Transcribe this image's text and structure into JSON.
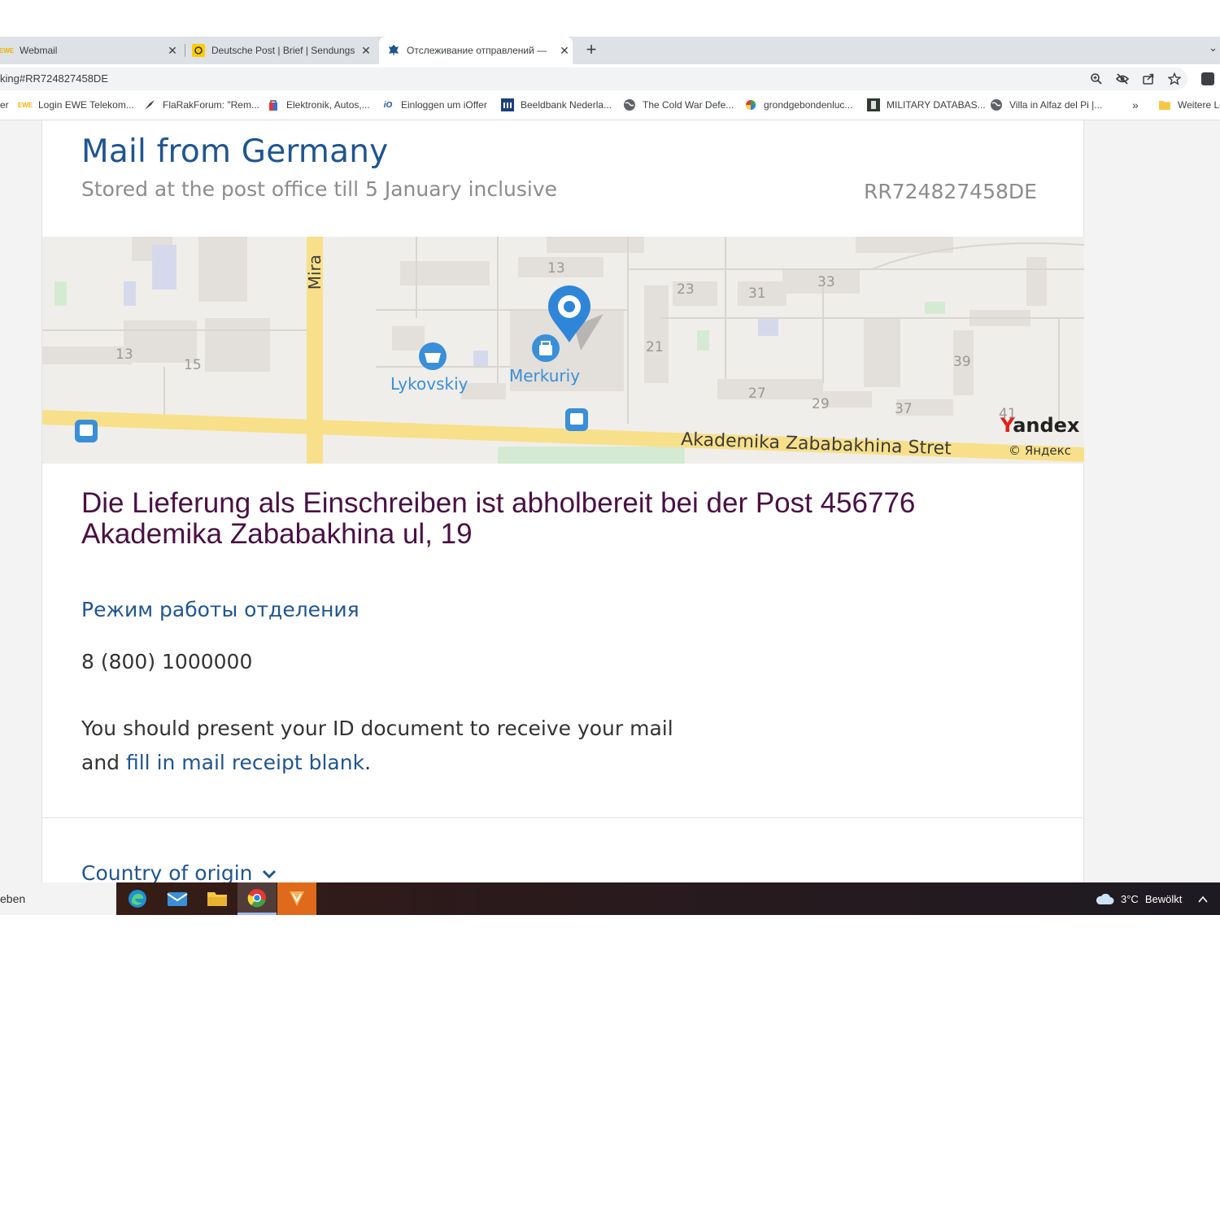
{
  "browser": {
    "tabs": [
      {
        "title": "Webmail",
        "favicon": "ewe-icon"
      },
      {
        "title": "Deutsche Post | Brief | Sendungs",
        "favicon": "deutsche-post-icon"
      },
      {
        "title": "Отслеживание отправлений —",
        "favicon": "russian-post-icon"
      }
    ],
    "new_tab_label": "+",
    "url": "king#RR724827458DE",
    "bookmarks": [
      {
        "label": "er"
      },
      {
        "label": "Login EWE Telekom..."
      },
      {
        "label": "FlaRakForum: \"Rem..."
      },
      {
        "label": "Elektronik, Autos,..."
      },
      {
        "label": "Einloggen um iOffer"
      },
      {
        "label": "Beeldbank Nederla..."
      },
      {
        "label": "The Cold War Defe..."
      },
      {
        "label": "grondgebondenluc..."
      },
      {
        "label": "MILITARY DATABAS..."
      },
      {
        "label": "Villa in Alfaz del Pi |..."
      }
    ],
    "bookmarks_overflow": "»",
    "other_bookmarks": "Weitere Le"
  },
  "page": {
    "title": "Mail from Germany",
    "subtitle": "Stored at the post office till 5 January inclusive",
    "tracking_number": "RR724827458DE",
    "map": {
      "street_labels": [
        "Mira",
        "Akademika Zababakhina Stret"
      ],
      "house_numbers": [
        "13",
        "23",
        "31",
        "33",
        "21",
        "13",
        "15",
        "39",
        "27",
        "29",
        "37",
        "41"
      ],
      "poi": [
        "Lykovskiy",
        "Merkuriy"
      ],
      "brand": "Yandex",
      "copyright": "© Яндекс",
      "colors": {
        "road": "#f8e08a",
        "block": "#e3dfda",
        "poi": "#3a8fd9",
        "pin": "#2f86d8"
      }
    },
    "delivery_line1": "Die Lieferung als Einschreiben ist abholbereit bei der Post 456776",
    "delivery_line2": "Akademika Zababakhina ul, 19",
    "hours_link": "Режим работы отделения",
    "phone": "8 (800) 1000000",
    "id_note_line1": "You should present your ID document to receive your mail",
    "id_note_and": "and ",
    "receipt_link": "fill in mail receipt blank",
    "id_note_end": ".",
    "country_of_origin": "Country of origin"
  },
  "taskbar": {
    "search_text": "eben",
    "apps": [
      "edge-icon",
      "mail-icon",
      "file-explorer-icon",
      "chrome-icon",
      "app-icon"
    ],
    "weather_temp": "3°C",
    "weather_condition": "Bewölkt"
  },
  "colors": {
    "title_blue": "#1f5591",
    "delivery_purple": "#4a1044",
    "subtitle_grey": "#8c8c8c"
  }
}
